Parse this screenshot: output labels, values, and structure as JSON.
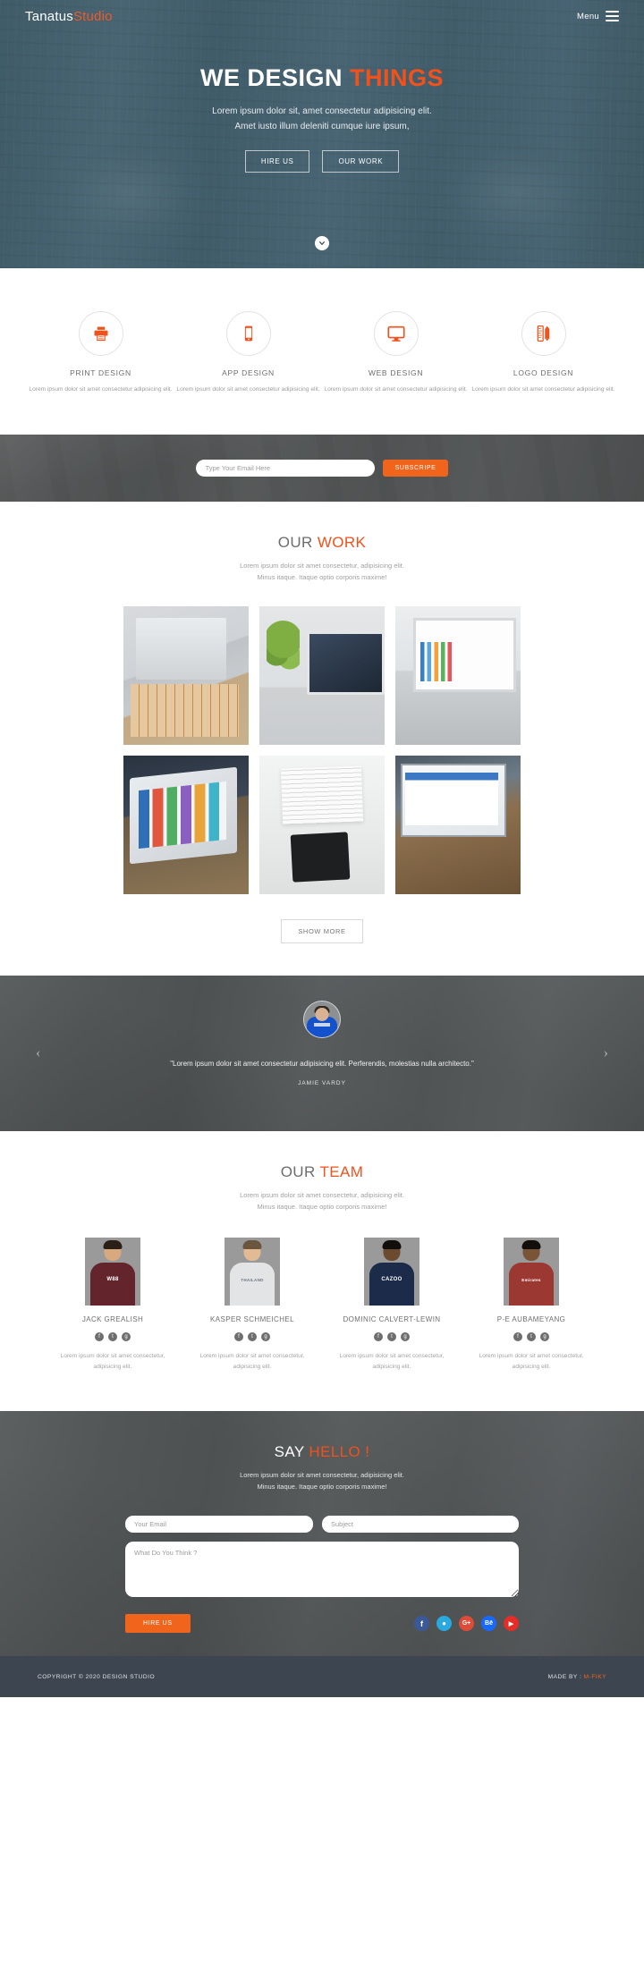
{
  "header": {
    "logo_main": "Tanatus",
    "logo_accent": "Studio",
    "menu_label": "Menu",
    "menu_icon": "hamburger-icon"
  },
  "hero": {
    "title_main": "WE DESIGN ",
    "title_accent": "THINGS",
    "subtitle_line1": "Lorem ipsum dolor sit, amet consectetur adipisicing elit.",
    "subtitle_line2": "Amet iusto illum deleniti cumque iure ipsum,",
    "btn_primary": "HIRE US",
    "btn_secondary": "OUR WORK",
    "scroll_icon": "chevron-down-icon"
  },
  "services": [
    {
      "icon": "printer-icon",
      "title": "PRINT DESIGN",
      "desc": "Lorem ipsum dolor sit amet consectetur adipisicing elit."
    },
    {
      "icon": "mobile-phone-icon",
      "title": "APP DESIGN",
      "desc": "Lorem ipsum dolor sit amet consectetur adipisicing elit."
    },
    {
      "icon": "monitor-icon",
      "title": "WEB DESIGN",
      "desc": "Lorem ipsum dolor sit amet consectetur adipisicing elit."
    },
    {
      "icon": "ruler-pen-icon",
      "title": "LOGO DESIGN",
      "desc": "Lorem ipsum dolor sit amet consectetur adipisicing elit."
    }
  ],
  "subscribe": {
    "placeholder": "Type Your Email Here",
    "value": "",
    "button": "SUBSCRIPE"
  },
  "work": {
    "title_main": "OUR ",
    "title_accent": "WORK",
    "sub_line1": "Lorem ipsum dolor sit amet consectetur, adipisicing elit.",
    "sub_line2": "Minus itaque. Itaque optio corporis maxime!",
    "items": [
      {
        "alt": "imac-and-tablet-on-desk"
      },
      {
        "alt": "imac-with-plant-on-desk"
      },
      {
        "alt": "laptop-showing-charts"
      },
      {
        "alt": "tablet-with-app-icons"
      },
      {
        "alt": "papers-and-tablet-flatlay"
      },
      {
        "alt": "laptop-with-web-app"
      }
    ],
    "show_more": "SHOW MORE"
  },
  "testimonial": {
    "avatar_alt": "jamie-vardy-avatar",
    "quote": "\"Lorem ipsum dolor sit amet consectetur adipisicing elit. Perferendis, molestias nulla architecto.\"",
    "author": "JAMIE VARDY",
    "prev_icon": "chevron-left-icon",
    "next_icon": "chevron-right-icon"
  },
  "team": {
    "title_main": "OUR ",
    "title_accent": "TEAM",
    "sub_line1": "Lorem ipsum dolor sit amet consectetur, adipisicing elit.",
    "sub_line2": "Minus itaque. Itaque optio corporis maxime!",
    "members": [
      {
        "name": "JACK GREALISH",
        "desc": "Lorem ipsum dolor sit amet consectetur, adipisicing elit.",
        "kit_text": "W88",
        "kit_color": "#63242c",
        "skin": "#d8a97f",
        "socials": [
          "facebook-icon",
          "twitter-icon",
          "google-plus-icon"
        ]
      },
      {
        "name": "KASPER SCHMEICHEL",
        "desc": "Lorem ipsum dolor sit amet consectetur, adipisicing elit.",
        "kit_text": "THAILAND",
        "kit_color": "#e2e4e6",
        "skin": "#e2bb95",
        "socials": [
          "facebook-icon",
          "twitter-icon",
          "google-plus-icon"
        ]
      },
      {
        "name": "DOMINIC CALVERT-LEWIN",
        "desc": "Lorem ipsum dolor sit amet consectetur, adipisicing elit.",
        "kit_text": "CAZOO",
        "kit_color": "#1d2b4a",
        "skin": "#6b4a30",
        "socials": [
          "facebook-icon",
          "twitter-icon",
          "google-plus-icon"
        ]
      },
      {
        "name": "P-E AUBAMEYANG",
        "desc": "Lorem ipsum dolor sit amet consectetur, adipisicing elit.",
        "kit_text": "Emirates",
        "kit_color": "#9c3832",
        "skin": "#7a5436",
        "socials": [
          "facebook-icon",
          "twitter-icon",
          "google-plus-icon"
        ]
      }
    ]
  },
  "contact": {
    "title_main": "SAY ",
    "title_accent": "HELLO !",
    "sub_line1": "Lorem ipsum dolor sit amet consectetur, adipisicing elit.",
    "sub_line2": "Minus itaque. Itaque optio corporis maxime!",
    "email_placeholder": "Your Email",
    "email_value": "",
    "subject_placeholder": "Subject",
    "subject_value": "",
    "message_placeholder": "What Do You Think ?",
    "message_value": "",
    "submit_label": "HIRE US",
    "socials": [
      {
        "name": "facebook-icon",
        "glyph": "f",
        "color": "#3b5998"
      },
      {
        "name": "twitter-icon",
        "glyph": "ᵀ",
        "color": "#29a9e0"
      },
      {
        "name": "google-plus-icon",
        "glyph": "G+",
        "color": "#dd4b39"
      },
      {
        "name": "behance-icon",
        "glyph": "Bė",
        "color": "#1769ff"
      },
      {
        "name": "youtube-icon",
        "glyph": "▶",
        "color": "#e52d27"
      }
    ]
  },
  "footer": {
    "copyright": "COPYRIGHT © 2020 DESIGN STUDIO",
    "made_by_label": "MADE BY : ",
    "made_by_name": "M-FIKY"
  },
  "colors": {
    "accent": "#f1511b",
    "accent_btn": "#f1641b",
    "hero_bg": "#4c6b7a",
    "dark_band": "#5a5d5e",
    "footer_bg": "#3d4550"
  }
}
